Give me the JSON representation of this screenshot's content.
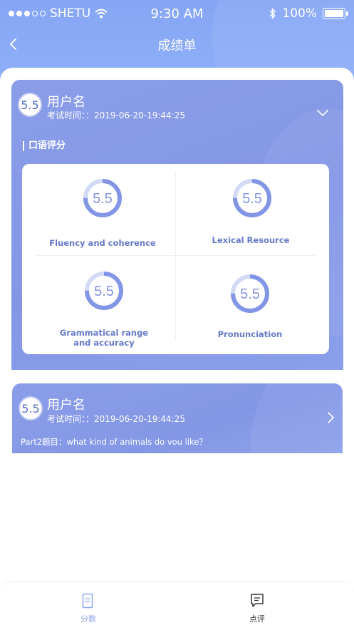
{
  "status_bar": {
    "carrier": "SHETU",
    "time": "9:30 AM",
    "battery": "100%"
  },
  "nav": {
    "title": "成绩单"
  },
  "record1": {
    "score": "5.5",
    "user_name": "用户名",
    "exam_time": "考试时间：：2019-06-20-19:44:25",
    "section_title": "口语评分",
    "metrics": [
      {
        "label": "Fluency and coherence",
        "score": "5.5",
        "progress": 0.75
      },
      {
        "label": "Lexical Resource",
        "score": "5.5",
        "progress": 0.75
      },
      {
        "label": "Grammatical range\nand accuracy",
        "score": "5.5",
        "progress": 0.75
      },
      {
        "label": "Pronunciation",
        "score": "5.5",
        "progress": 0.75
      }
    ]
  },
  "record2": {
    "score": "5.5",
    "user_name": "用户名",
    "exam_time": "考试时间：：2019-06-20-19:44:25",
    "question": "Part2题目：what kind of animals do vou like？"
  },
  "tabs": [
    {
      "label": "分数",
      "active": true
    },
    {
      "label": "点评",
      "active": false
    }
  ],
  "colors": {
    "accent": "#8396e5",
    "metric_text": "#6679c9",
    "tab_active": "#8da4ef",
    "tab_inactive": "#333333"
  }
}
